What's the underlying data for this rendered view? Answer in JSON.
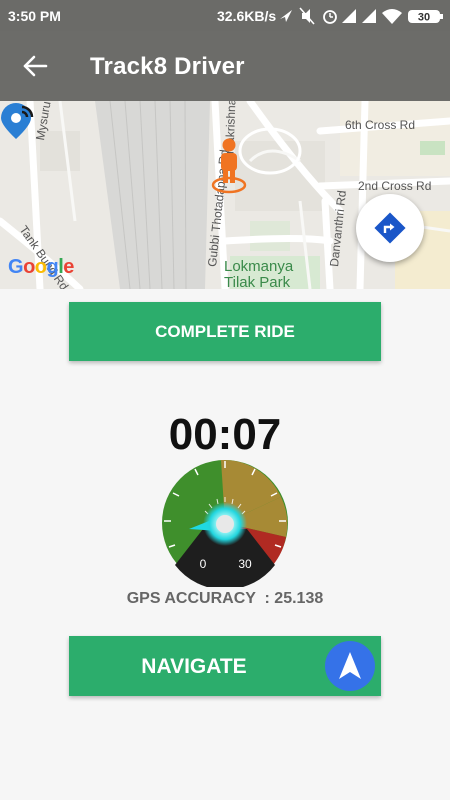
{
  "status_bar": {
    "time": "3:50 PM",
    "network_rate": "32.6KB/s",
    "battery": "30",
    "icons": [
      "location-arrow-icon",
      "mute-icon",
      "alarm-icon",
      "signal-icon",
      "signal-icon",
      "wifi-icon",
      "battery-icon"
    ]
  },
  "app_bar": {
    "title": "Track8 Driver",
    "back_icon": "arrow-back-icon"
  },
  "map": {
    "labels": {
      "mysuru_rd": "Mysuru Rd",
      "tank_bund": "Tank Bund Rd",
      "ramakrishnappa_rd": "Ramakrishnappa Rd",
      "gubbi_rd": "Gubbi Thotadappa Rd",
      "sixth_cross": "6th Cross Rd",
      "second_cross": "2nd Cross Rd",
      "danvanthri_rd": "Danvanthri Rd",
      "park_line1": "Lokmanya",
      "park_line2": "Tilak Park"
    },
    "google_logo": "Google",
    "directions_icon": "directions-icon"
  },
  "complete_ride": {
    "label": "COMPLETE RIDE"
  },
  "timer": {
    "value": "00:07"
  },
  "gauge": {
    "min_label": "0",
    "max_label": "30"
  },
  "gps": {
    "label": "GPS ACCURACY  : 25.138"
  },
  "navigate": {
    "label": "NAVIGATE",
    "icon": "navigation-arrow-icon"
  },
  "colors": {
    "accent_green": "#2cad6c",
    "app_bar": "#6c6c69",
    "fab_blue": "#3572e8",
    "gauge_green": "#3f8f2c",
    "gauge_amber": "#a78a35",
    "gauge_red": "#b02a22"
  }
}
